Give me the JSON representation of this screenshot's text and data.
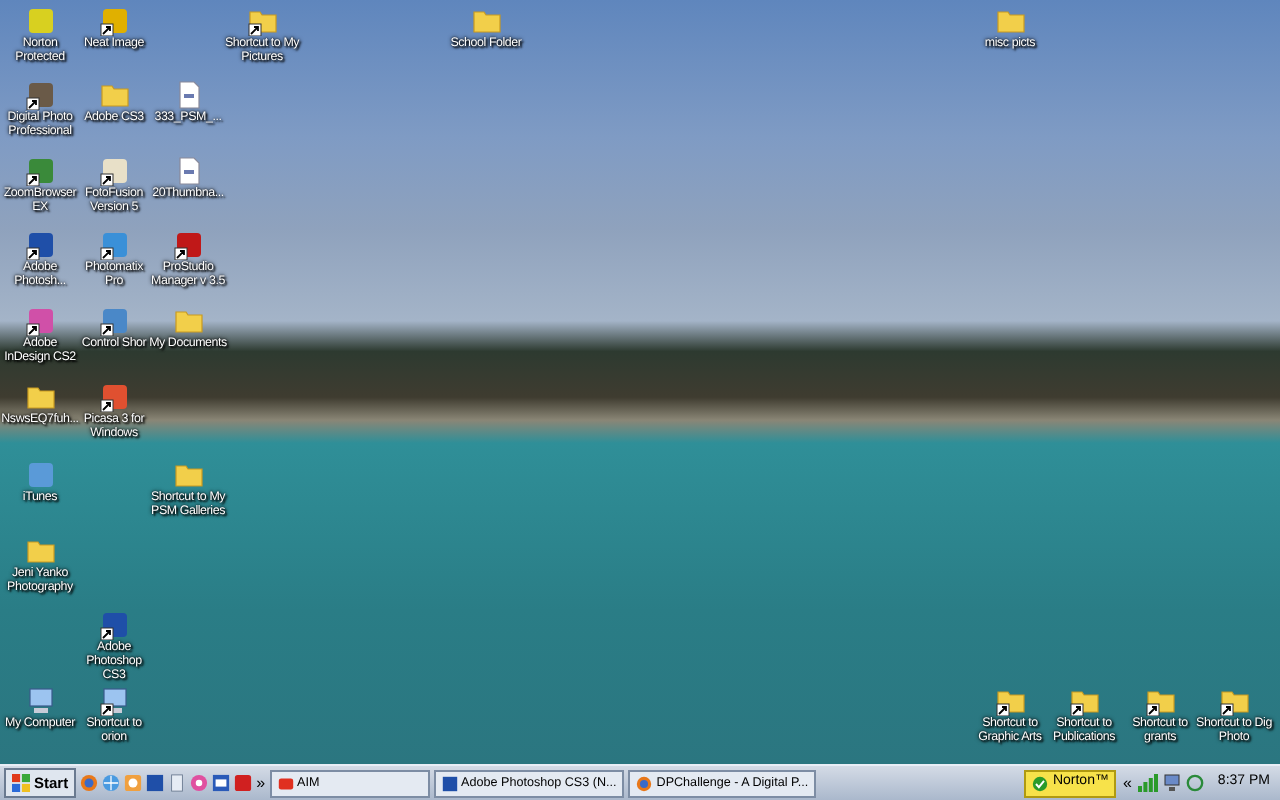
{
  "desktop": {
    "icons": [
      {
        "label": "Norton Protected",
        "kind": "app",
        "color": "#d8d020",
        "shortcut": false
      },
      {
        "label": "Neat Image",
        "kind": "app",
        "color": "#e0b000",
        "shortcut": true
      },
      {
        "label": "Shortcut to My Pictures",
        "kind": "folder",
        "shortcut": true
      },
      {
        "label": "School Folder",
        "kind": "folder",
        "shortcut": false
      },
      {
        "label": "misc picts",
        "kind": "folder",
        "shortcut": false
      },
      {
        "label": "Digital Photo Professional",
        "kind": "app",
        "color": "#6a5a48",
        "shortcut": true
      },
      {
        "label": "Adobe CS3",
        "kind": "folder",
        "shortcut": false
      },
      {
        "label": "333_PSM_...",
        "kind": "document",
        "shortcut": false
      },
      {
        "label": "ZoomBrowser EX",
        "kind": "app",
        "color": "#3a8a3a",
        "shortcut": true
      },
      {
        "label": "FotoFusion Version 5",
        "kind": "app",
        "color": "#e8e0c8",
        "shortcut": true
      },
      {
        "label": "20Thumbna...",
        "kind": "document",
        "shortcut": false
      },
      {
        "label": "Adobe Photosh...",
        "kind": "app",
        "color": "#1f4fa8",
        "shortcut": true
      },
      {
        "label": "Photomatix Pro",
        "kind": "app",
        "color": "#3a90d8",
        "shortcut": true
      },
      {
        "label": "ProStudio Manager v 3.5",
        "kind": "app",
        "color": "#c01818",
        "shortcut": true
      },
      {
        "label": "Adobe InDesign CS2",
        "kind": "app",
        "color": "#d050a8",
        "shortcut": true
      },
      {
        "label": "Control Shor",
        "kind": "app",
        "color": "#4a88c8",
        "shortcut": true
      },
      {
        "label": "My Documents",
        "kind": "folder",
        "shortcut": false
      },
      {
        "label": "NswsEQ7fuh...",
        "kind": "folder",
        "shortcut": false
      },
      {
        "label": "Picasa 3 for Windows",
        "kind": "app",
        "color": "#e05030",
        "shortcut": true
      },
      {
        "label": "iTunes",
        "kind": "app",
        "color": "#5a9ad8",
        "shortcut": false
      },
      {
        "label": "Shortcut to My PSM Galleries",
        "kind": "folder",
        "shortcut": false
      },
      {
        "label": "Jeni Yanko Photography",
        "kind": "folder",
        "shortcut": false
      },
      {
        "label": "Adobe Photoshop CS3",
        "kind": "app",
        "color": "#1f4fa8",
        "shortcut": true
      },
      {
        "label": "My Computer",
        "kind": "computer",
        "shortcut": false
      },
      {
        "label": "Shortcut to orion",
        "kind": "computer",
        "shortcut": true
      },
      {
        "label": "Shortcut to Graphic Arts",
        "kind": "folder",
        "shortcut": true
      },
      {
        "label": "Shortcut to Publications",
        "kind": "folder",
        "shortcut": true
      },
      {
        "label": "Shortcut to grants",
        "kind": "folder",
        "shortcut": true
      },
      {
        "label": "Shortcut to Dig Photo",
        "kind": "folder",
        "shortcut": true
      }
    ]
  },
  "taskbar": {
    "start": "Start",
    "more": "»",
    "tasks": [
      {
        "label": "AIM",
        "selected": false
      },
      {
        "label": "Adobe Photoshop CS3 (N...",
        "selected": false
      },
      {
        "label": "DPChallenge - A Digital P...",
        "selected": false
      }
    ],
    "norton": "Norton™",
    "tray_expand": "«",
    "clock": "8:37 PM"
  }
}
